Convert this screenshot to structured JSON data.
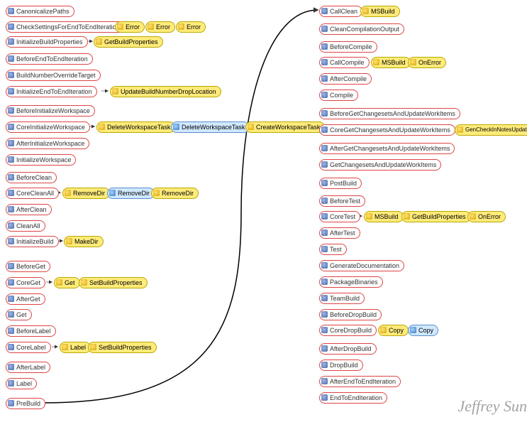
{
  "watermark": "Jeffrey Sun",
  "left": {
    "CanonicalizePaths": "CanonicalizePaths",
    "CheckSettingsForEndToEndIteration": "CheckSettingsForEndToEndIteration",
    "Error1": "Error",
    "Error2": "Error",
    "Error3": "Error",
    "InitializeBuildProperties": "InitializeBuildProperties",
    "GetBuildProperties1": "GetBuildProperties",
    "BeforeEndToEndIteration": "BeforeEndToEndIteration",
    "BuildNumberOverrideTarget": "BuildNumberOverrideTarget",
    "InitializeEndToEndIteration": "InitializeEndToEndIteration",
    "UpdateBuildNumberDropLocation": "UpdateBuildNumberDropLocation",
    "BeforeInitializeWorkspace": "BeforeInitializeWorkspace",
    "CoreInitializeWorkspace": "CoreInitializeWorkspace",
    "DeleteWorkspaceTask1": "DeleteWorkspaceTask",
    "DeleteWorkspaceTask2": "DeleteWorkspaceTask",
    "CreateWorkspaceTask": "CreateWorkspaceTask",
    "AfterInitializeWorkspace": "AfterInitializeWorkspace",
    "InitializeWorkspace": "InitializeWorkspace",
    "BeforeClean": "BeforeClean",
    "CoreCleanAll": "CoreCleanAll",
    "RemoveDir1": "RemoveDir",
    "RemoveDir2": "RemoveDir",
    "RemoveDir3": "RemoveDir",
    "AfterClean": "AfterClean",
    "CleanAll": "CleanAll",
    "InitializeBuild": "InitializeBuild",
    "MakeDir": "MakeDir",
    "BeforeGet": "BeforeGet",
    "CoreGet": "CoreGet",
    "Get": "Get",
    "SetBuildProperties1": "SetBuildProperties",
    "AfterGet": "AfterGet",
    "GetPlain": "Get",
    "BeforeLabel": "BeforeLabel",
    "CoreLabel": "CoreLabel",
    "Label": "Label",
    "SetBuildProperties2": "SetBuildProperties",
    "AfterLabel": "AfterLabel",
    "LabelPlain": "Label",
    "PreBuild": "PreBuild"
  },
  "right": {
    "CallClean": "CallClean",
    "MSBuild1": "MSBuild",
    "CleanCompilationOutput": "CleanCompilationOutput",
    "BeforeCompile": "BeforeCompile",
    "CallCompile": "CallCompile",
    "MSBuild2": "MSBuild",
    "OnError1": "OnError",
    "AfterCompile": "AfterCompile",
    "Compile": "Compile",
    "BeforeGetChangesetsAndUpdateWorkItems": "BeforeGetChangesetsAndUpdateWorkItems",
    "CoreGetChangesetsAndUpdateWorkItems": "CoreGetChangesetsAndUpdateWorkItems",
    "GenCheckInNotesUpdateWorkItems": "GenCheckInNotesUpdateWorkItems",
    "AfterGetChangesetsAndUpdateWorkItems": "AfterGetChangesetsAndUpdateWorkItems",
    "GetChangesetsAndUpdateWorkItems": "GetChangesetsAndUpdateWorkItems",
    "PostBuild": "PostBuild",
    "BeforeTest": "BeforeTest",
    "CoreTest": "CoreTest",
    "MSBuild3": "MSBuild",
    "GetBuildProperties2": "GetBuildProperties",
    "OnError2": "OnError",
    "AfterTest": "AfterTest",
    "Test": "Test",
    "GenerateDocumentation": "GenerateDocumentation",
    "PackageBinaries": "PackageBinaries",
    "TeamBuild": "TeamBuild",
    "BeforeDropBuild": "BeforeDropBuild",
    "CoreDropBuild": "CoreDropBuild",
    "Copy1": "Copy",
    "Copy2": "Copy",
    "AfterDropBuild": "AfterDropBuild",
    "DropBuild": "DropBuild",
    "AfterEndToEndIteration": "AfterEndToEndIteration",
    "EndToEndIteration": "EndToEndIteration"
  }
}
